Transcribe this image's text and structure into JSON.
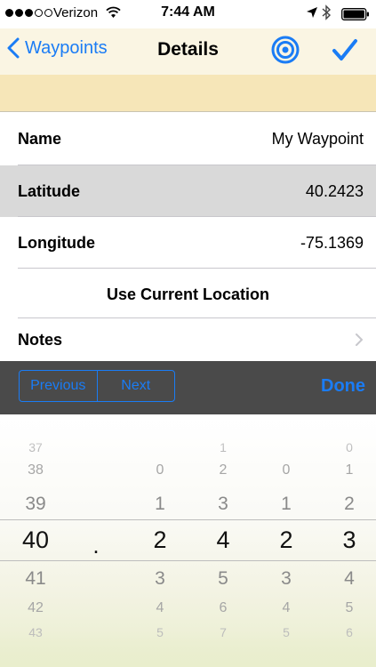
{
  "status_bar": {
    "carrier": "Verizon",
    "time": "7:44 AM"
  },
  "nav": {
    "back_label": "Waypoints",
    "title": "Details",
    "accent": "#1a7cf5"
  },
  "fields": {
    "name": {
      "label": "Name",
      "value": "My Waypoint"
    },
    "latitude": {
      "label": "Latitude",
      "value": "40.2423"
    },
    "longitude": {
      "label": "Longitude",
      "value": "-75.1369"
    },
    "use_current": "Use Current Location",
    "notes": "Notes"
  },
  "toolbar": {
    "previous": "Previous",
    "next": "Next",
    "done": "Done"
  },
  "picker": {
    "decimal": ".",
    "columns": [
      {
        "above": [
          "37",
          "38",
          "39"
        ],
        "selected": "40",
        "below": [
          "41",
          "42",
          "43"
        ]
      },
      {
        "above": [
          "",
          "0",
          "1"
        ],
        "selected": "2",
        "below": [
          "3",
          "4",
          "5"
        ]
      },
      {
        "above": [
          "1",
          "2",
          "3"
        ],
        "selected": "4",
        "below": [
          "5",
          "6",
          "7"
        ]
      },
      {
        "above": [
          "",
          "0",
          "1"
        ],
        "selected": "2",
        "below": [
          "3",
          "4",
          "5"
        ]
      },
      {
        "above": [
          "0",
          "1",
          "2"
        ],
        "selected": "3",
        "below": [
          "4",
          "5",
          "6"
        ]
      }
    ]
  }
}
